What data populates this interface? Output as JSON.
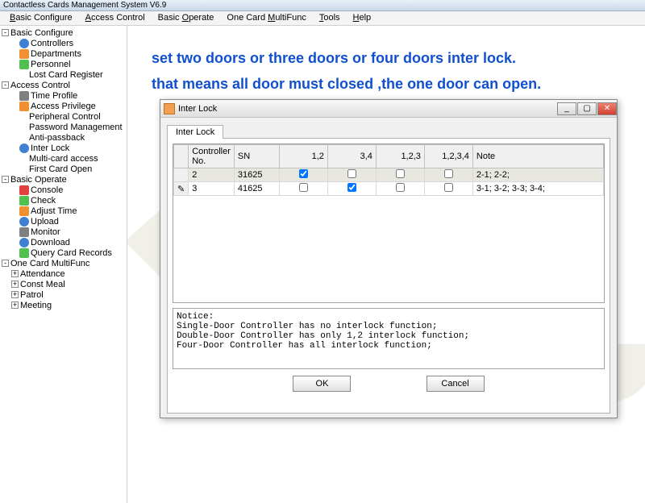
{
  "app": {
    "title": "Contactless Cards Management System  V6.9"
  },
  "menu": [
    "Basic Configure",
    "Access Control",
    "Basic Operate",
    "One Card MultiFunc",
    "Tools",
    "Help"
  ],
  "menu_ul": [
    "B",
    "A",
    "O",
    "M",
    "T",
    "H"
  ],
  "tree": {
    "n0": "Basic Configure",
    "n1": "Controllers",
    "n2": "Departments",
    "n3": "Personnel",
    "n4": "Lost Card Register",
    "n5": "Access Control",
    "n6": "Time Profile",
    "n7": "Access Privilege",
    "n8": "Peripheral Control",
    "n9": "Password Management",
    "n10": "Anti-passback",
    "n11": "Inter Lock",
    "n12": "Multi-card access",
    "n13": "First Card Open",
    "n14": "Basic Operate",
    "n15": "Console",
    "n16": "Check",
    "n17": "Adjust Time",
    "n18": "Upload",
    "n19": "Monitor",
    "n20": "Download",
    "n21": "Query Card Records",
    "n22": "One Card MultiFunc",
    "n23": "Attendance",
    "n24": "Const Meal",
    "n25": "Patrol",
    "n26": "Meeting"
  },
  "annot": {
    "l1": "set two doors or three doors or four doors inter lock.",
    "l2": "that means all door must closed ,the one door can open."
  },
  "dialog": {
    "title": "Inter Lock",
    "tab": "Inter Lock",
    "cols": {
      "c0": "Controller No.",
      "c1": "SN",
      "c2": "1,2",
      "c3": "3,4",
      "c4": "1,2,3",
      "c5": "1,2,3,4",
      "c6": "Note"
    },
    "rows": [
      {
        "no": "2",
        "sn": "31625",
        "c12": true,
        "c34": false,
        "c123": false,
        "c1234": false,
        "note": "2-1;  2-2;"
      },
      {
        "no": "3",
        "sn": "41625",
        "c12": false,
        "c34": true,
        "c123": false,
        "c1234": false,
        "note": "3-1;  3-2;  3-3;  3-4;"
      }
    ],
    "notice": {
      "h": "Notice:",
      "l1": "Single-Door Controller has no interlock function;",
      "l2": "Double-Door Controller has only 1,2 interlock function;",
      "l3": "Four-Door Controller has all interlock function;"
    },
    "ok": "OK",
    "cancel": "Cancel"
  }
}
